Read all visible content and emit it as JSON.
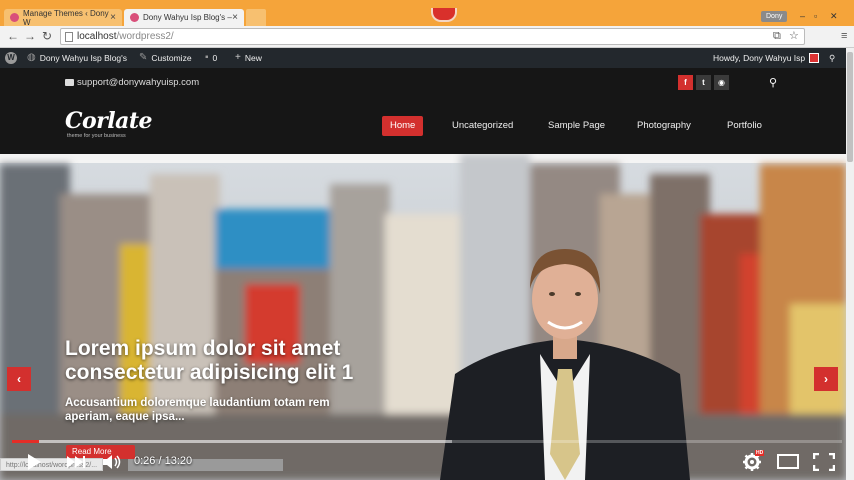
{
  "browser": {
    "tabs": [
      {
        "title": "Manage Themes ‹ Dony W",
        "active": false
      },
      {
        "title": "Dony Wahyu Isp Blog's – ",
        "active": true
      }
    ],
    "profile": "Dony",
    "url_host": "localhost",
    "url_path": "/wordpress2/"
  },
  "adminbar": {
    "site_name": "Dony Wahyu Isp Blog's",
    "customize": "Customize",
    "comments_count": "0",
    "new_label": "New",
    "howdy": "Howdy, Dony Wahyu Isp"
  },
  "site": {
    "support_email": "support@donywahyuisp.com",
    "logo": "Corlate",
    "tagline": "theme for your business",
    "menu": [
      "Home",
      "Uncategorized",
      "Sample Page",
      "Photography",
      "Portfolio"
    ],
    "active_menu": "Home"
  },
  "slider": {
    "title": "Lorem ipsum dolor sit amet consectetur adipisicing elit 1",
    "subtitle": "Accusantium doloremque laudantium totam rem aperiam, eaque ipsa...",
    "button": "Read More",
    "prev": "‹",
    "next": "›"
  },
  "status_url": "http://localhost/wordpress2/...",
  "video": {
    "current_time": "0:26",
    "duration": "13:20",
    "time_display": "0:26 / 13:20",
    "played_fraction": 0.0325,
    "loaded_fraction": 0.53,
    "hd_badge": "HD"
  },
  "colors": {
    "accent": "#d3302e",
    "adminbar": "#23282d",
    "header": "#161616",
    "browser_frame": "#f5a43a",
    "youtube_red": "#e52d27"
  }
}
